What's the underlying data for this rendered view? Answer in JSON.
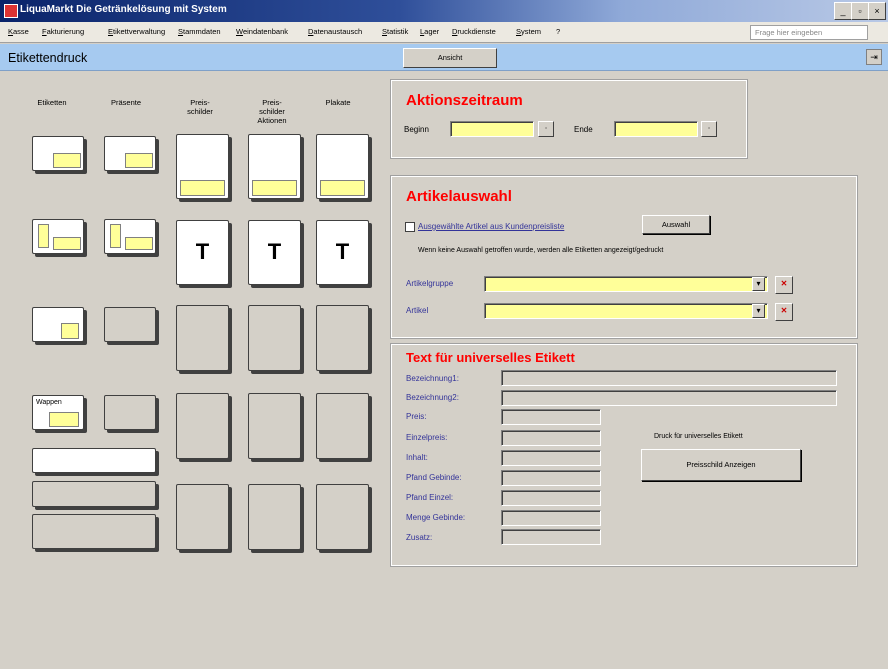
{
  "window": {
    "title": "LiquaMarkt Die Getränkelösung mit System"
  },
  "menu": [
    "Kasse",
    "Fakturierung",
    "Etikettverwaltung",
    "Stammdaten",
    "Weindatenbank",
    "Datenaustausch",
    "Statistik",
    "Lager",
    "Druckdienste",
    "System",
    "?"
  ],
  "help_placeholder": "Frage hier eingeben",
  "form": {
    "title": "Etikettendruck",
    "view_button": "Ansicht"
  },
  "columns": [
    "Etiketten",
    "Präsente",
    "Preis-\nschilder",
    "Preis-\nschilder\nAktionen",
    "Plakate"
  ],
  "tiles": {
    "t_letter": "T",
    "wappen": "Wappen"
  },
  "aktion": {
    "title": "Aktionszeitraum",
    "begin_label": "Beginn",
    "end_label": "Ende",
    "begin_value": "",
    "end_value": ""
  },
  "artikel": {
    "title": "Artikelauswahl",
    "checkbox_label": "Ausgewählte Artikel aus Kundenpreisliste",
    "select_button": "Auswahl",
    "hint": "Wenn keine Auswahl getroffen wurde, werden alle Etiketten angezeigt/gedruckt",
    "group_label": "Artikelgruppe",
    "article_label": "Artikel",
    "group_value": "",
    "article_value": ""
  },
  "universal": {
    "title": "Text für universelles Etikett",
    "fields": [
      "Bezeichnung1:",
      "Bezeichnung2:",
      "Preis:",
      "Einzelpreis:",
      "Inhalt:",
      "Pfand Gebinde:",
      "Pfand Einzel:",
      "Menge Gebinde:",
      "Zusatz:"
    ],
    "print_label": "Druck für universelles Etikett",
    "print_button": "Preisschild Anzeigen"
  },
  "colors": {
    "accent_red": "#ff0000",
    "field_yellow": "#ffff99",
    "header_blue": "#a6caf0",
    "label_blue": "#333399"
  }
}
